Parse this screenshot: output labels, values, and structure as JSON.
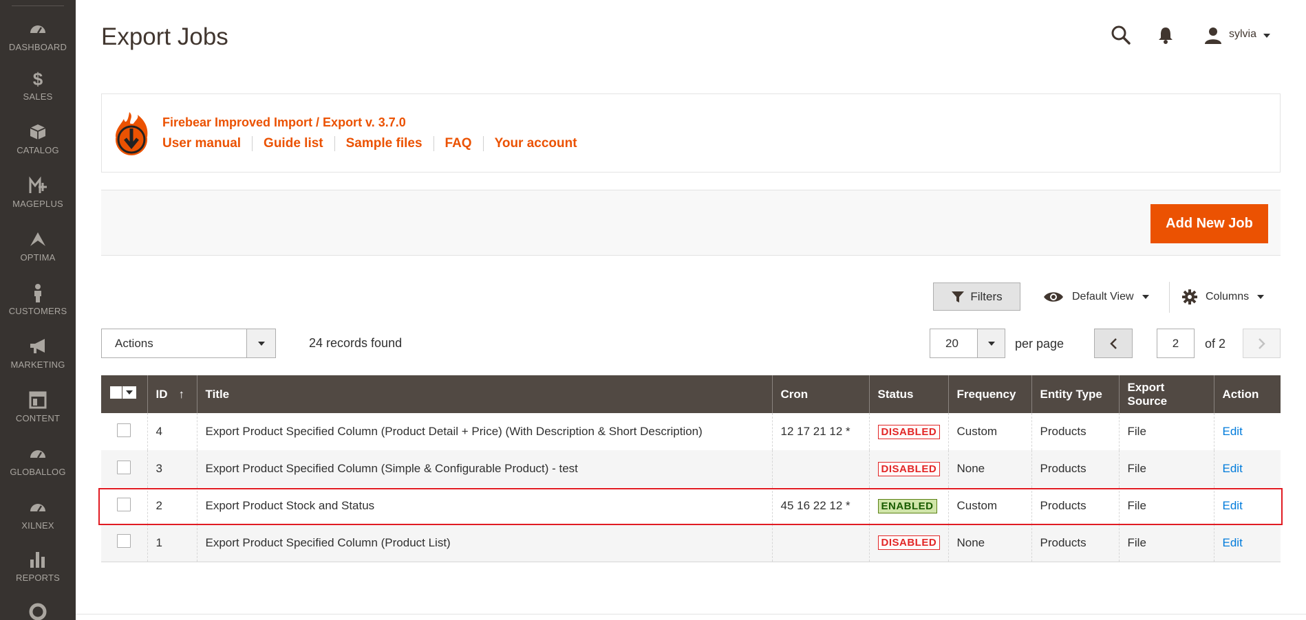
{
  "sidebar": {
    "items": [
      {
        "label": "DASHBOARD",
        "icon": "dashboard-icon"
      },
      {
        "label": "SALES",
        "icon": "dollar-icon"
      },
      {
        "label": "CATALOG",
        "icon": "cube-icon"
      },
      {
        "label": "MAGEPLUS",
        "icon": "mageplus-icon"
      },
      {
        "label": "OPTIMA",
        "icon": "optima-icon"
      },
      {
        "label": "CUSTOMERS",
        "icon": "person-icon"
      },
      {
        "label": "MARKETING",
        "icon": "megaphone-icon"
      },
      {
        "label": "CONTENT",
        "icon": "content-icon"
      },
      {
        "label": "GLOBALLOG",
        "icon": "gauge-icon"
      },
      {
        "label": "XILNEX",
        "icon": "gauge-icon"
      },
      {
        "label": "REPORTS",
        "icon": "bar-chart-icon"
      }
    ]
  },
  "header": {
    "title": "Export Jobs",
    "user": "sylvia"
  },
  "firebear": {
    "title": "Firebear Improved Import / Export v. 3.7.0",
    "links": [
      "User manual",
      "Guide list",
      "Sample files",
      "FAQ",
      "Your account"
    ]
  },
  "toolbar": {
    "add_label": "Add New Job",
    "filters_label": "Filters",
    "view_label": "Default View",
    "columns_label": "Columns",
    "actions_label": "Actions",
    "records_text": "24 records found",
    "per_page_value": "20",
    "per_page_label": "per page",
    "page_value": "2",
    "page_of": "of 2"
  },
  "grid": {
    "columns": [
      "ID",
      "Title",
      "Cron",
      "Status",
      "Frequency",
      "Entity Type",
      "Export Source",
      "Action"
    ],
    "rows": [
      {
        "id": "4",
        "title": "Export Product Specified Column (Product Detail + Price) (With Description & Short Description)",
        "cron": "12 17 21 12 *",
        "status": "DISABLED",
        "frequency": "Custom",
        "entity": "Products",
        "source": "File",
        "action": "Edit"
      },
      {
        "id": "3",
        "title": "Export Product Specified Column (Simple & Configurable Product) - test",
        "cron": "",
        "status": "DISABLED",
        "frequency": "None",
        "entity": "Products",
        "source": "File",
        "action": "Edit"
      },
      {
        "id": "2",
        "title": "Export Product Stock and Status",
        "cron": "45 16 22 12 *",
        "status": "ENABLED",
        "frequency": "Custom",
        "entity": "Products",
        "source": "File",
        "action": "Edit"
      },
      {
        "id": "1",
        "title": "Export Product Specified Column (Product List)",
        "cron": "",
        "status": "DISABLED",
        "frequency": "None",
        "entity": "Products",
        "source": "File",
        "action": "Edit"
      }
    ]
  },
  "colors": {
    "accent": "#eb5202",
    "sidebar": "#373330",
    "table_header": "#514943",
    "link": "#007bdb",
    "highlight": "#e11b22"
  }
}
